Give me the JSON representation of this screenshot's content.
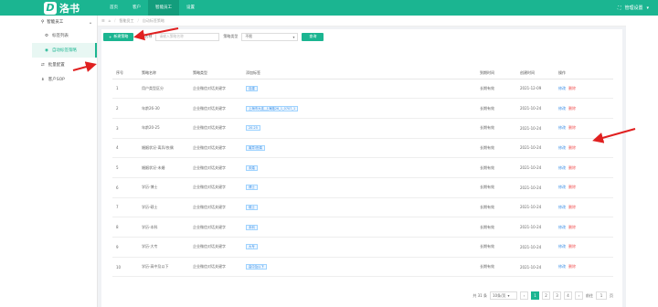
{
  "app": {
    "logo_letter": "D",
    "logo_text": "洛书"
  },
  "nav": [
    "首页",
    "客户",
    "智能员工",
    "设置"
  ],
  "user": {
    "label": "管理设置"
  },
  "sidebar": {
    "group": "智能员工",
    "items": [
      {
        "label": "标签列表"
      },
      {
        "label": "自动标签策略"
      },
      {
        "label": "批量配置"
      },
      {
        "label": "客户SOP"
      }
    ]
  },
  "breadcrumb": [
    "智能员工",
    "自动标签策略"
  ],
  "toolbar": {
    "new_button": "新建策略",
    "name_label": "策略名称",
    "name_placeholder": "请输入策略名称",
    "type_label": "策略类型",
    "type_value": "不限",
    "query_button": "查询"
  },
  "columns": [
    "序号",
    "策略名称",
    "策略类型",
    "添加标签",
    "",
    "到期时间",
    "创建时间",
    "操作"
  ],
  "rows": [
    {
      "no": "1",
      "name": "用户类型区分",
      "type": "企业微信对话关键字",
      "tag": "自建",
      "expire": "长期有效",
      "created": "2021-12-09"
    },
    {
      "no": "2",
      "name": "年龄26-30",
      "type": "企业微信对话关键字",
      "tag": "上海市大连_上海路26_1_0707_1",
      "expire": "长期有效",
      "created": "2021-10-24"
    },
    {
      "no": "3",
      "name": "年龄20-25",
      "type": "企业微信对话关键字",
      "tag": "20-25",
      "expire": "长期有效",
      "created": "2021-10-24"
    },
    {
      "no": "4",
      "name": "婚姻状况-离异/丧偶",
      "type": "企业微信对话关键字",
      "tag": "离异/丧偶",
      "expire": "长期有效",
      "created": "2021-10-24"
    },
    {
      "no": "5",
      "name": "婚姻状况-未婚",
      "type": "企业微信对话关键字",
      "tag": "未婚",
      "expire": "长期有效",
      "created": "2021-10-24"
    },
    {
      "no": "6",
      "name": "学历-博士",
      "type": "企业微信对话关键字",
      "tag": "博士",
      "expire": "长期有效",
      "created": "2021-10-24"
    },
    {
      "no": "7",
      "name": "学历-硕士",
      "type": "企业微信对话关键字",
      "tag": "硕士",
      "expire": "长期有效",
      "created": "2021-10-24"
    },
    {
      "no": "8",
      "name": "学历-本科",
      "type": "企业微信对话关键字",
      "tag": "本科",
      "expire": "长期有效",
      "created": "2021-10-24"
    },
    {
      "no": "9",
      "name": "学历-大专",
      "type": "企业微信对话关键字",
      "tag": "大专",
      "expire": "长期有效",
      "created": "2021-10-24"
    },
    {
      "no": "10",
      "name": "学历-高中及以下",
      "type": "企业微信对话关键字",
      "tag": "高中及以下",
      "expire": "长期有效",
      "created": "2021-10-24"
    }
  ],
  "row_actions": {
    "edit": "修改",
    "delete": "删除"
  },
  "pagination": {
    "total": "共 31 条",
    "page_size": "10条/页",
    "pages": [
      "1",
      "2",
      "3",
      "4"
    ],
    "goto_label": "前往",
    "goto_value": "1",
    "page_unit": "页"
  },
  "colors": {
    "brand": "#1bb591",
    "annotation_arrow": "#e02020"
  }
}
